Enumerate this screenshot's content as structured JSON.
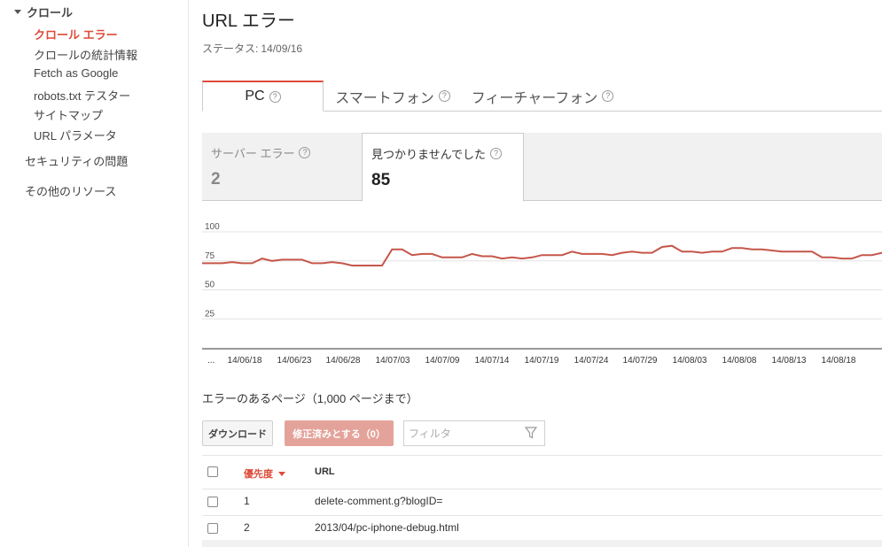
{
  "sidebar": {
    "section_label": "クロール",
    "items": [
      {
        "label": "クロール エラー",
        "active": true
      },
      {
        "label": "クロールの統計情報",
        "active": false
      },
      {
        "label": "Fetch as Google",
        "active": false
      },
      {
        "label": "robots.txt テスター",
        "active": false
      },
      {
        "label": "サイトマップ",
        "active": false
      },
      {
        "label": "URL パラメータ",
        "active": false
      }
    ],
    "security_label": "セキュリティの問題",
    "other_resources_label": "その他のリソース"
  },
  "header": {
    "title": "URL エラー",
    "status_label": "ステータス:",
    "status_date": "14/09/16"
  },
  "tabs": [
    {
      "label": "PC",
      "active": true
    },
    {
      "label": "スマートフォン",
      "active": false
    },
    {
      "label": "フィーチャーフォン",
      "active": false
    }
  ],
  "metrics": [
    {
      "label": "サーバー エラー",
      "value": "2",
      "active": false
    },
    {
      "label": "見つかりませんでした",
      "value": "85",
      "active": true
    }
  ],
  "chart_data": {
    "type": "line",
    "series": [
      {
        "color": "#c5574a",
        "values": [
          73,
          73,
          73,
          74,
          73,
          73,
          77,
          75,
          76,
          76,
          76,
          73,
          73,
          74,
          73,
          71,
          71,
          71,
          71,
          85,
          85,
          80,
          81,
          81,
          78,
          78,
          78,
          81,
          79,
          79,
          77,
          78,
          77,
          78,
          80,
          80,
          80,
          83,
          81,
          81,
          81,
          80,
          82,
          83,
          82,
          82,
          87,
          88,
          83,
          83,
          82,
          83,
          83,
          86,
          86,
          85,
          85,
          84,
          83,
          83,
          83,
          83,
          78,
          78,
          77,
          77,
          80,
          80,
          82
        ]
      }
    ],
    "x_tick_labels": [
      "...",
      "14/06/18",
      "14/06/23",
      "14/06/28",
      "14/07/03",
      "14/07/09",
      "14/07/14",
      "14/07/19",
      "14/07/24",
      "14/07/29",
      "14/08/03",
      "14/08/08",
      "14/08/13",
      "14/08/18"
    ],
    "y_ticks": [
      100,
      75,
      50,
      25
    ],
    "ylim": [
      0,
      100
    ],
    "grid": true,
    "legend": "none"
  },
  "list": {
    "title": "エラーのあるページ（1,000 ページまで）",
    "download_label": "ダウンロード",
    "mark_fixed_label": "修正済みとする（0）",
    "filter_placeholder": "フィルタ",
    "col_priority": "優先度",
    "col_url": "URL",
    "rows": [
      {
        "priority": "1",
        "url": "delete-comment.g?blogID="
      },
      {
        "priority": "2",
        "url": "2013/04/pc-iphone-debug.html"
      }
    ]
  },
  "colors": {
    "accent": "#dd4b39",
    "series": "#c5574a"
  },
  "icons": {
    "section_toggle": "triangle-down-icon",
    "help": "help-icon",
    "filter": "filter-icon",
    "sort": "sort-down-icon"
  }
}
